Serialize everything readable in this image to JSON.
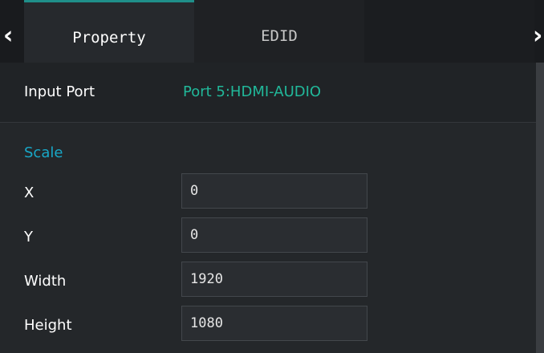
{
  "tabs": {
    "prev_icon": "chevron-left-icon",
    "next_icon": "chevron-right-icon",
    "items": [
      {
        "label": "Property",
        "active": true
      },
      {
        "label": "EDID",
        "active": false
      }
    ]
  },
  "input_port": {
    "label": "Input Port",
    "value": "Port 5:HDMI-AUDIO"
  },
  "scale": {
    "title": "Scale",
    "fields": [
      {
        "label": "X",
        "value": "0"
      },
      {
        "label": "Y",
        "value": "0"
      },
      {
        "label": "Width",
        "value": "1920"
      },
      {
        "label": "Height",
        "value": "1080"
      }
    ]
  },
  "colors": {
    "accent": "#1f8f8a",
    "value_green": "#21b89a",
    "section_blue": "#18a8c8",
    "background": "#24272a"
  }
}
